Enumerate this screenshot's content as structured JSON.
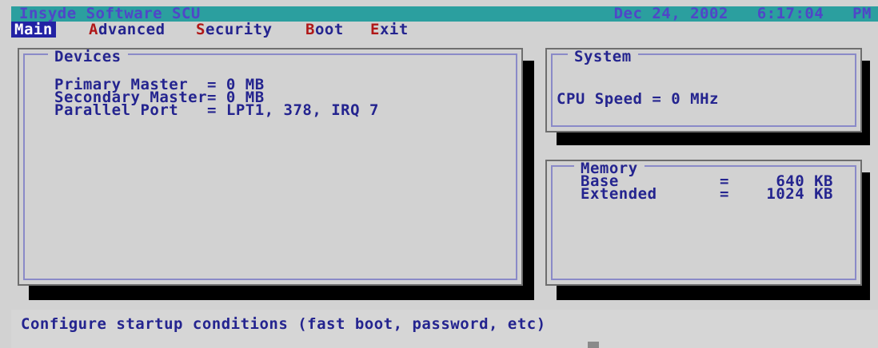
{
  "title_bar": {
    "app_name": "Insyde Software SCU",
    "date": "Dec 24, 2002",
    "time": "6:17:04",
    "ampm": "PM"
  },
  "menu": {
    "items": [
      {
        "hot": "M",
        "rest": "ain"
      },
      {
        "hot": "A",
        "rest": "dvanced"
      },
      {
        "hot": "S",
        "rest": "ecurity"
      },
      {
        "hot": "B",
        "rest": "oot"
      },
      {
        "hot": "E",
        "rest": "xit"
      }
    ],
    "active": "Main"
  },
  "devices": {
    "title": "Devices",
    "rows": [
      "Primary Master  = 0 MB",
      "Secondary Master= 0 MB",
      "Parallel Port   = LPT1, 378, IRQ 7"
    ]
  },
  "system": {
    "title": "System",
    "cpu_speed": "CPU Speed = 0 MHz"
  },
  "memory": {
    "title": "Memory",
    "base_label": "Base",
    "base_eq": "=",
    "base_value": "640 KB",
    "extended_label": "Extended",
    "extended_eq": "=",
    "extended_value": "1024 KB"
  },
  "status_text": "Configure startup conditions (fast boot, password, etc)",
  "colors": {
    "background": "#d2d2d2",
    "title_bar": "#2b9f9f",
    "text": "#24248f",
    "hotkey": "#b01818",
    "menu_highlight": "#2222a4"
  }
}
